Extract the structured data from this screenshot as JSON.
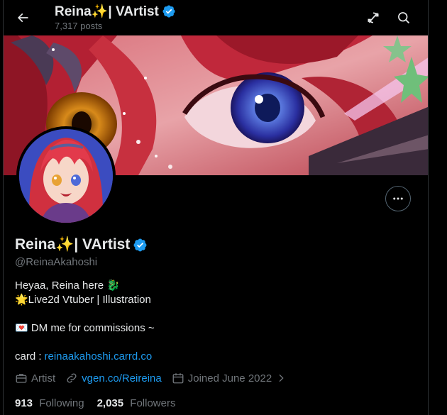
{
  "header": {
    "title": "Reina✨| VArtist",
    "post_count": "7,317 posts"
  },
  "profile": {
    "display_name": "Reina✨| VArtist",
    "handle": "@ReinaAkahoshi",
    "bio_line1": "Heyaa, Reina here 🐉",
    "bio_line2": "🌟Live2d Vtuber | Illustration",
    "bio_line3": "💌 DM me for commissions ~",
    "card_label": "card : ",
    "card_link": "reinaakahoshi.carrd.co",
    "category": "Artist",
    "website": "vgen.co/Reireina",
    "joined": "Joined June 2022"
  },
  "stats": {
    "following_count": "913",
    "following_label": "Following",
    "followers_count": "2,035",
    "followers_label": "Followers"
  },
  "icons": {
    "back": "arrow-left-icon",
    "sync": "sync-icon",
    "search": "search-icon",
    "more": "more-icon",
    "verified": "verified-badge-icon",
    "briefcase": "briefcase-icon",
    "link": "link-icon",
    "calendar": "calendar-icon"
  },
  "colors": {
    "accent": "#1d9bf0",
    "background": "#000000",
    "muted": "#71767b",
    "verified": "#1d9bf0"
  }
}
